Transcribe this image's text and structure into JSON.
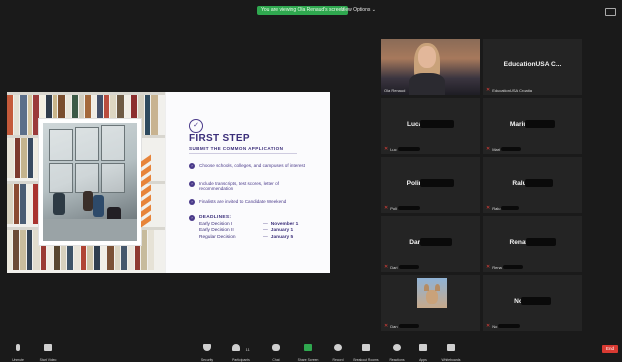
{
  "topbar": {
    "share_pill": "You are viewing Ola Renaud's screen",
    "view_options": "View Options ⌄"
  },
  "slide": {
    "step_title": "FIRST STEP",
    "step_subtitle": "SUBMIT THE COMMON APPLICATION",
    "bullets": [
      "Choose schools, colleges, and campuses of interest",
      "Include transcripts, test scores, letter of recommendation",
      "Finalists are invited to Candidate Weekend"
    ],
    "deadlines_title": "DEADLINES:",
    "deadlines": [
      {
        "name": "Early Decision I",
        "sep": "—",
        "date": "November 1"
      },
      {
        "name": "Early Decision II",
        "sep": "—",
        "date": "January 1"
      },
      {
        "name": "Regular Decision",
        "sep": "—",
        "date": "January 5"
      }
    ]
  },
  "gallery": {
    "tiles": [
      {
        "name": "",
        "footer": "Ola Renaud"
      },
      {
        "name": "EducationUSA C...",
        "footer": "EducationUSA Croatia"
      },
      {
        "name": "Lucas",
        "footer": "Luc"
      },
      {
        "name": "Marius",
        "footer": "Mari"
      },
      {
        "name": "Polina",
        "footer": "Poli"
      },
      {
        "name": "Ralu",
        "footer": "Ralu"
      },
      {
        "name": "Daria",
        "footer": "Dari"
      },
      {
        "name": "Renata",
        "footer": "Rena"
      },
      {
        "name": "",
        "footer": "Dan"
      },
      {
        "name": "No",
        "footer": "No"
      }
    ]
  },
  "toolbar": {
    "items": [
      {
        "label": "Unmute",
        "icon": "mic-icon"
      },
      {
        "label": "Start Video",
        "icon": "video-icon"
      },
      {
        "label": "Security",
        "icon": "shield-icon"
      },
      {
        "label": "Participants",
        "icon": "people-icon",
        "count": "11"
      },
      {
        "label": "Chat",
        "icon": "chat-icon"
      },
      {
        "label": "Share Screen",
        "icon": "share-screen-icon"
      },
      {
        "label": "Record",
        "icon": "record-icon"
      },
      {
        "label": "Breakout Rooms",
        "icon": "grid-icon"
      },
      {
        "label": "Reactions",
        "icon": "smile-icon"
      },
      {
        "label": "Apps",
        "icon": "apps-icon"
      },
      {
        "label": "Whiteboards",
        "icon": "whiteboard-icon"
      }
    ],
    "end": "End"
  },
  "colors": {
    "accent_green": "#2fa84f",
    "slide_purple": "#3c2f7a",
    "slide_orange": "#e7843a",
    "end_red": "#d93a32",
    "active_speaker": "#b8d234"
  }
}
